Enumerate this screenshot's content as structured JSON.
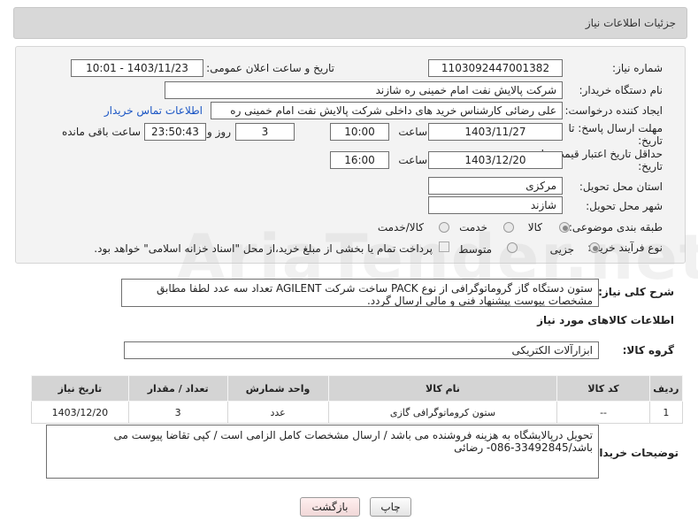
{
  "header": {
    "title": "جزئیات اطلاعات نیاز"
  },
  "need_number": {
    "label": "شماره نیاز:",
    "value": "1103092447001382"
  },
  "announce": {
    "label": "تاریخ و ساعت اعلان عمومی:",
    "value": "1403/11/23 - 10:01"
  },
  "buyer_org": {
    "label": "نام دستگاه خریدار:",
    "value": "شرکت پالایش نفت امام خمینی  ره   شازند"
  },
  "requester": {
    "label": "ایجاد کننده درخواست:",
    "value": "علی  رضائی کارشناس خرید های داخلی  شرکت پالایش نفت امام خمینی  ره",
    "contact_link": "اطلاعات تماس خریدار"
  },
  "deadline": {
    "label1": "مهلت ارسال پاسخ: تا",
    "label2": "تاریخ:",
    "date": "1403/11/27",
    "time_label": "ساعت",
    "time": "10:00",
    "days": "3",
    "days_label": "روز و",
    "remaining": "23:50:43",
    "remaining_label": "ساعت باقی مانده"
  },
  "validity": {
    "label1": "حداقل تاریخ اعتبار قیمت: تا",
    "label2": "تاریخ:",
    "date": "1403/12/20",
    "time_label": "ساعت",
    "time": "16:00"
  },
  "province": {
    "label": "استان محل تحویل:",
    "value": "مرکزی"
  },
  "city": {
    "label": "شهر محل تحویل:",
    "value": "شازند"
  },
  "category": {
    "label": "طبقه بندی موضوعی:",
    "options": [
      "کالا",
      "خدمت",
      "کالا/خدمت"
    ]
  },
  "process": {
    "label": "نوع فرآیند خرید :",
    "options": [
      "جزیی",
      "متوسط"
    ],
    "note": "پرداخت تمام یا بخشی از مبلغ خرید،از محل \"اسناد خزانه اسلامی\" خواهد بود."
  },
  "summary": {
    "label": "شرح کلی نیاز:",
    "line1": "ستون دستگاه گاز گروماتوگرافی از نوع PACK  ساخت شرکت AGILENT   تعداد سه عدد لطفا مطابق",
    "line2": "مشخصات پیوست پیشنهاد فنی و مالی ارسال گردد."
  },
  "goods_info": {
    "title": "اطلاعات کالاهای مورد نیاز"
  },
  "goods_group": {
    "label": "گروه کالا:",
    "value": "ابزارآلات الکتریکی"
  },
  "table": {
    "headers": [
      "ردیف",
      "کد کالا",
      "نام کالا",
      "واحد شمارش",
      "تعداد / مقدار",
      "تاریخ نیاز"
    ],
    "rows": [
      [
        "1",
        "--",
        "ستون کروماتوگرافی گازی",
        "عدد",
        "3",
        "1403/12/20"
      ]
    ]
  },
  "buyer_notes": {
    "label": "توضیحات خریدار:",
    "line1": "تحویل درپالایشگاه به هزینه فروشنده می باشد / ارسال مشخصات کامل الزامی است / کپی تقاضا پیوست می",
    "line2": "باشد/33492845-086- رضائی"
  },
  "buttons": {
    "print": "چاپ",
    "back": "بازگشت"
  },
  "watermark": "AriaTender.net"
}
